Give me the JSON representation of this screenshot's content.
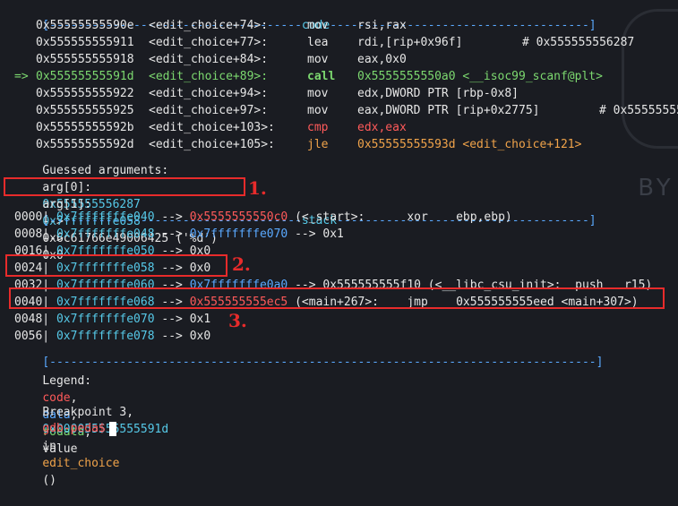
{
  "code_header": {
    "left": "[------------------------------------",
    "title": "code",
    "right": "-------------------------------------]"
  },
  "code_lines": [
    {
      "arrow": "",
      "addr": "0x55555555590e",
      "sym": "<edit_choice+74>:",
      "mnem": "mov",
      "mnem_color": "white",
      "ops": "rsi,rax",
      "comment": ""
    },
    {
      "arrow": "",
      "addr": "0x555555555911",
      "sym": "<edit_choice+77>:",
      "mnem": "lea",
      "mnem_color": "white",
      "ops": "rdi,[rip+0x96f]",
      "comment": "# 0x555555556287"
    },
    {
      "arrow": "",
      "addr": "0x555555555918",
      "sym": "<edit_choice+84>:",
      "mnem": "mov",
      "mnem_color": "white",
      "ops": "eax,0x0",
      "comment": ""
    },
    {
      "arrow": "=>",
      "addr": "0x55555555591d",
      "sym": "<edit_choice+89>:",
      "mnem": "call",
      "mnem_color": "green",
      "ops": "0x5555555550a0 <__isoc99_scanf@plt>",
      "comment": ""
    },
    {
      "arrow": "",
      "addr": "0x555555555922",
      "sym": "<edit_choice+94>:",
      "mnem": "mov",
      "mnem_color": "white",
      "ops": "edx,DWORD PTR [rbp-0x8]",
      "comment": ""
    },
    {
      "arrow": "",
      "addr": "0x555555555925",
      "sym": "<edit_choice+97>:",
      "mnem": "mov",
      "mnem_color": "white",
      "ops": "eax,DWORD PTR [rip+0x2775]",
      "comment": "# 0x55555555"
    },
    {
      "arrow": "",
      "addr": "0x55555555592b",
      "sym": "<edit_choice+103>:",
      "mnem": "cmp",
      "mnem_color": "red",
      "ops": "edx,eax",
      "comment": ""
    },
    {
      "arrow": "",
      "addr": "0x55555555592d",
      "sym": "<edit_choice+105>:",
      "mnem": "jle",
      "mnem_color": "orange",
      "ops": "0x55555555593d <edit_choice+121>",
      "comment": ""
    }
  ],
  "guessed_label": "Guessed arguments:",
  "args": [
    {
      "name": "arg[0]:",
      "addr": "0x555555556287",
      "arrow": "-->",
      "value": "0x6c61766e49006425 ('%d')"
    },
    {
      "name": "arg[1]:",
      "addr": "0x7fffffffe058",
      "arrow": "-->",
      "value": "0x0"
    }
  ],
  "stack_header": {
    "left": "[------------------------------------",
    "title": "stack",
    "right": "------------------------------------]"
  },
  "stack_lines": [
    {
      "off": "0000|",
      "addr": "0x7fffffffe040",
      "arrow": "-->",
      "val": "0x5555555550c0",
      "val_color": "red",
      "rest": "(<_start>:      xor    ebp,ebp)"
    },
    {
      "off": "0008|",
      "addr": "0x7fffffffe048",
      "arrow": "-->",
      "val": "0x7fffffffe070",
      "val_color": "blue",
      "rest": "--> 0x1"
    },
    {
      "off": "0016|",
      "addr": "0x7fffffffe050",
      "arrow": "-->",
      "val": "0x0",
      "val_color": "white",
      "rest": ""
    },
    {
      "off": "0024|",
      "addr": "0x7fffffffe058",
      "arrow": "-->",
      "val": "0x0",
      "val_color": "white",
      "rest": ""
    },
    {
      "off": "0032|",
      "addr": "0x7fffffffe060",
      "arrow": "-->",
      "val": "0x7fffffffe0a0",
      "val_color": "blue",
      "rest": "--> 0x555555555f10 (<__libc_csu_init>:  push   r15)"
    },
    {
      "off": "0040|",
      "addr": "0x7fffffffe068",
      "arrow": "-->",
      "val": "0x555555555ec5",
      "val_color": "red",
      "rest": "(<main+267>:    jmp    0x555555555eed <main+307>)"
    },
    {
      "off": "0048|",
      "addr": "0x7fffffffe070",
      "arrow": "-->",
      "val": "0x1",
      "val_color": "white",
      "rest": ""
    },
    {
      "off": "0056|",
      "addr": "0x7fffffffe078",
      "arrow": "-->",
      "val": "0x0",
      "val_color": "white",
      "rest": ""
    }
  ],
  "bottom_rule": "[------------------------------------------------------------------------------]",
  "legend": {
    "label": "Legend:",
    "code": "code",
    "sep1": ",",
    "data": "data",
    "sep2": ",",
    "rodata": "rodata",
    "sep3": ",",
    "value": "value"
  },
  "breakpoint": {
    "prefix": "Breakpoint 3,",
    "addr": "0x000055555555591d",
    "in": "in",
    "func": "edit_choice",
    "suffix": "()"
  },
  "prompt": "gdb-peda$",
  "annotations": [
    "1.",
    "2.",
    "3."
  ],
  "watermark": "BY C",
  "colors": {
    "background": "#1a1c22",
    "highlight_box": "#e82b2b"
  }
}
